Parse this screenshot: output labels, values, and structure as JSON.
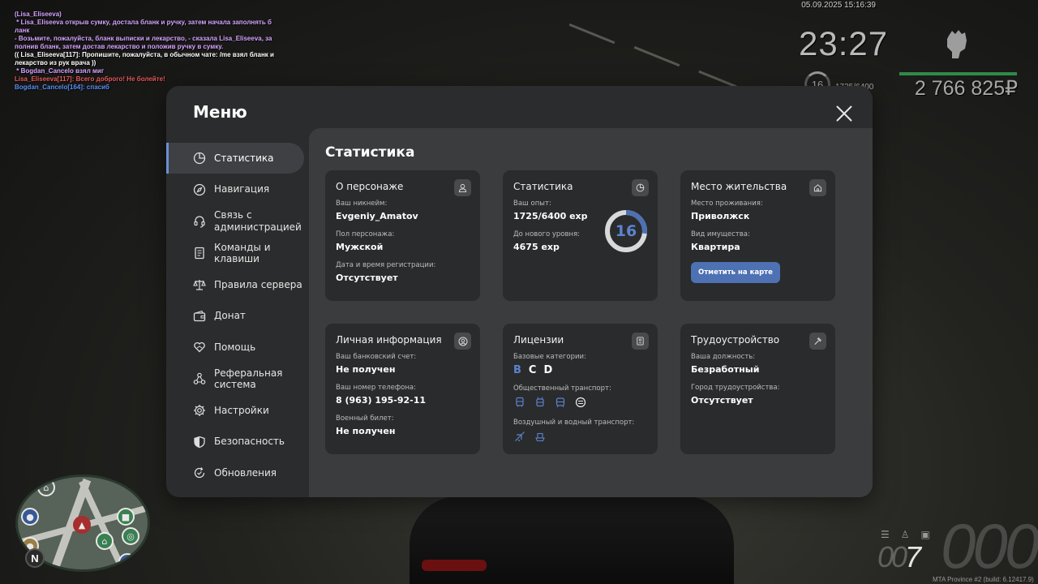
{
  "chat": [
    {
      "text": "(Lisa_Eliseeva)",
      "color": "#d6a4ff"
    },
    {
      "text": " * Lisa_Eliseeva открыв сумку, достала бланк и ручку, затем начала заполнять б ланк",
      "color": "#d6a4ff"
    },
    {
      "text": "- Возьмите, пожалуйста, бланк выписки и лекарство, - сказала Lisa_Eliseeva, за полнив бланк, затем достав лекарство и положив ручку в сумку.",
      "color": "#d6a4ff"
    },
    {
      "text": "(( Lisa_Eliseeva[117]: Пропишите, пожалуйста, в обычном чате: /me взял бланк и  лекарство из рук врача ))",
      "color": "#ffffff"
    },
    {
      "text": " * Bogdan_Cancelo взял миг",
      "color": "#d6a4ff"
    },
    {
      "text": "Lisa_Eliseeva[117]: Всего доброго! Не болейте!",
      "color": "#e35b5b"
    },
    {
      "text": "Bogdan_Cancelo[164]: спасиб",
      "color": "#5b8ff0"
    }
  ],
  "hud": {
    "date": "05.09.2025 15:16:39",
    "time": "23:27",
    "level": "16",
    "xp": "1725/6400",
    "money": "2 766 825₽",
    "speed": "000",
    "gear_prefix": "00",
    "gear": "7",
    "build": "MTA Province #2 (build: 6.12417.9)",
    "health_fraction": 1.0
  },
  "menu": {
    "title": "Меню",
    "close_icon": "close-icon",
    "sidebar": [
      {
        "label": "Статистика",
        "icon": "pie-chart-icon",
        "active": true
      },
      {
        "label": "Навигация",
        "icon": "compass-icon",
        "active": false
      },
      {
        "label": "Связь с администрацией",
        "icon": "headset-icon",
        "active": false
      },
      {
        "label": "Команды и клавиши",
        "icon": "document-icon",
        "active": false
      },
      {
        "label": "Правила сервера",
        "icon": "scales-icon",
        "active": false
      },
      {
        "label": "Донат",
        "icon": "wallet-icon",
        "active": false
      },
      {
        "label": "Помощь",
        "icon": "heart-hand-icon",
        "active": false
      },
      {
        "label": "Реферальная система",
        "icon": "network-icon",
        "active": false
      },
      {
        "label": "Настройки",
        "icon": "gear-icon",
        "active": false
      },
      {
        "label": "Безопасность",
        "icon": "shield-icon",
        "active": false
      },
      {
        "label": "Обновления",
        "icon": "refresh-check-icon",
        "active": false
      }
    ],
    "content_title": "Статистика",
    "cards": {
      "character": {
        "title": "О персонаже",
        "icon": "user-icon",
        "nick_label": "Ваш никнейм:",
        "nick": "Evgeniy_Amatov",
        "gender_label": "Пол персонажа:",
        "gender": "Мужской",
        "reg_label": "Дата и время регистрации:",
        "reg": "Отсутствует"
      },
      "stats": {
        "title": "Статистика",
        "icon": "pie-chart-icon",
        "exp_label": "Ваш опыт:",
        "exp": "1725/6400 exp",
        "next_label": "До нового уровня:",
        "next": "4675 exp",
        "level": "16",
        "progress": 0.27
      },
      "residence": {
        "title": "Место жительства",
        "icon": "home-icon",
        "place_label": "Место проживания:",
        "place": "Приволжск",
        "property_label": "Вид имущества:",
        "property": "Квартира",
        "map_button": "Отметить на карте"
      },
      "personal": {
        "title": "Личная информация",
        "icon": "user-circle-icon",
        "bank_label": "Ваш банковский счет:",
        "bank": "Не получен",
        "phone_label": "Ваш номер телефона:",
        "phone": "8 (963) 195-92-11",
        "military_label": "Военный билет:",
        "military": "Не получен"
      },
      "licenses": {
        "title": "Лицензии",
        "icon": "id-card-icon",
        "base_label": "Базовые категории:",
        "base": [
          {
            "cat": "B",
            "owned": true
          },
          {
            "cat": "C",
            "owned": false
          },
          {
            "cat": "D",
            "owned": false
          }
        ],
        "public_label": "Общественный транспорт:",
        "public_icons": [
          "bus-icon",
          "trolleybus-icon",
          "tram-icon",
          "subway-icon"
        ],
        "air_label": "Воздушный и водный транспорт:",
        "air_icons": [
          "plane-icon",
          "boat-icon"
        ]
      },
      "job": {
        "title": "Трудоустройство",
        "icon": "hammer-icon",
        "position_label": "Ваша должность:",
        "position": "Безработный",
        "city_label": "Город трудоустройства:",
        "city": "Отсутствует"
      }
    }
  }
}
